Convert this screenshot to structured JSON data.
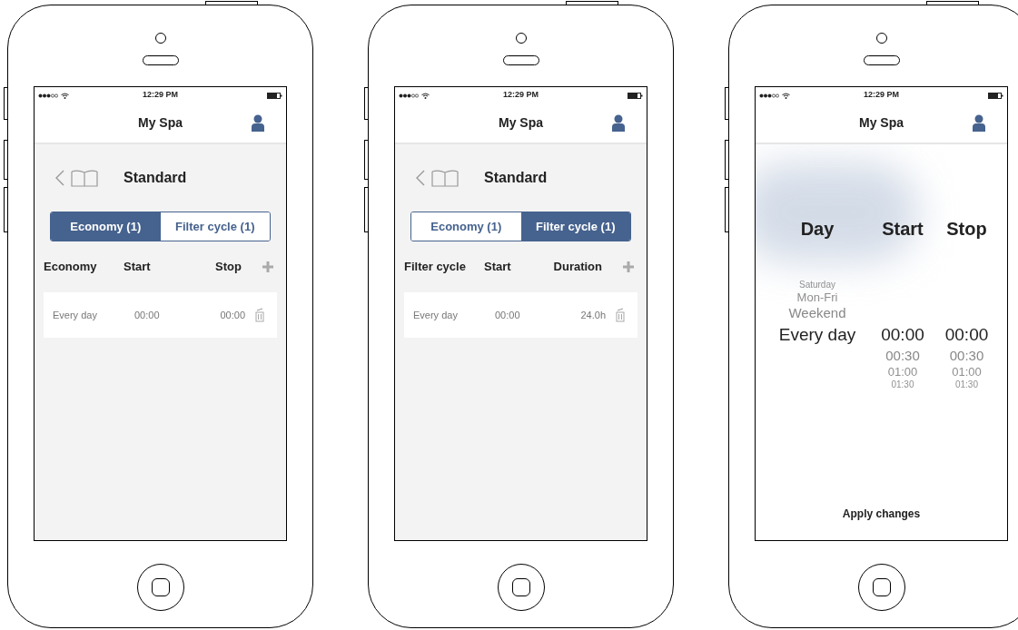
{
  "screens": [
    {
      "kind": "schedule",
      "status_bar": {
        "time": "12:29 PM"
      },
      "title": "My Spa",
      "program": "Standard",
      "tabs": [
        {
          "label": "Economy (1)",
          "selected": true
        },
        {
          "label": "Filter cycle (1)",
          "selected": false
        }
      ],
      "columns": [
        "Economy",
        "Start",
        "Stop"
      ],
      "rows": [
        [
          "Every day",
          "00:00",
          "00:00"
        ]
      ]
    },
    {
      "kind": "schedule",
      "status_bar": {
        "time": "12:29 PM"
      },
      "title": "My Spa",
      "program": "Standard",
      "tabs": [
        {
          "label": "Economy (1)",
          "selected": false
        },
        {
          "label": "Filter cycle (1)",
          "selected": true
        }
      ],
      "columns": [
        "Filter cycle",
        "Start",
        "Duration"
      ],
      "rows": [
        [
          "Every day",
          "00:00",
          "24.0h"
        ]
      ]
    },
    {
      "kind": "picker",
      "status_bar": {
        "time": "12:29 PM"
      },
      "title": "My Spa",
      "pickers": [
        {
          "heading": "Day",
          "options": [
            {
              "label": "Saturday",
              "selected": false
            },
            {
              "label": "Mon-Fri",
              "selected": false
            },
            {
              "label": "Weekend",
              "selected": false
            },
            {
              "label": "Every day",
              "selected": true
            }
          ]
        },
        {
          "heading": "Start",
          "options": [
            {
              "label": "00:00",
              "selected": true
            },
            {
              "label": "00:30",
              "selected": false
            },
            {
              "label": "01:00",
              "selected": false
            },
            {
              "label": "01:30",
              "selected": false
            }
          ]
        },
        {
          "heading": "Stop",
          "options": [
            {
              "label": "00:00",
              "selected": true
            },
            {
              "label": "00:30",
              "selected": false
            },
            {
              "label": "01:00",
              "selected": false
            },
            {
              "label": "01:30",
              "selected": false
            }
          ]
        }
      ],
      "apply_button": "Apply changes"
    }
  ]
}
